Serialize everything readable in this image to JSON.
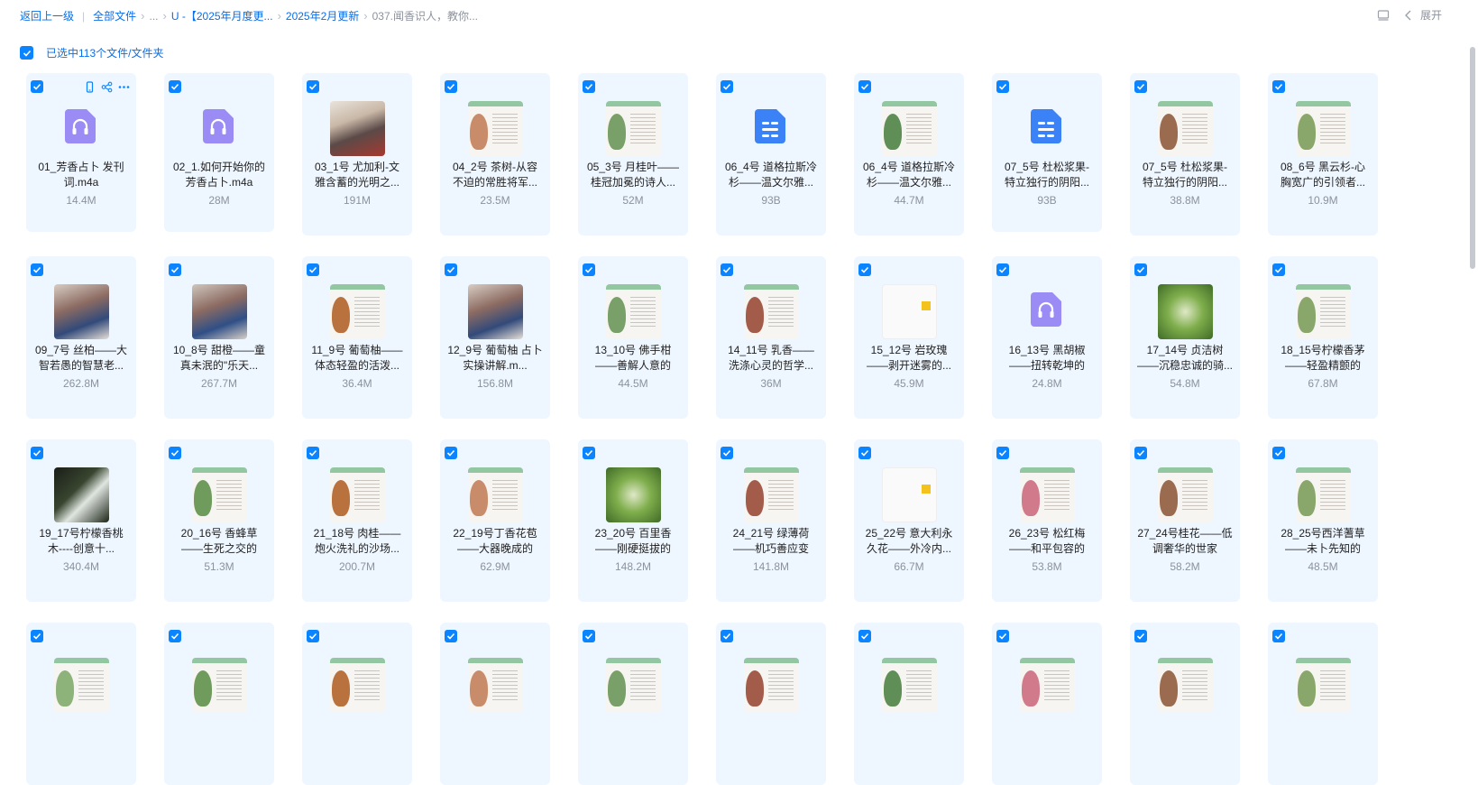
{
  "breadcrumb": {
    "back": "返回上一级",
    "all_files": "全部文件",
    "ellipsis": "...",
    "level1": "U -【2025年月度更...",
    "level2": "2025年2月更新",
    "current": "037.闻香识人，教你..."
  },
  "top_right": {
    "expand_label": "展开",
    "layout_icon": "layout-icon",
    "chevron_icon": "chevron-left-icon"
  },
  "selection": {
    "label": "已选中113个文件/文件夹"
  },
  "colors": {
    "accent": "#0a84ff",
    "link": "#0a6ee8",
    "card_bg": "#eef6ff",
    "audio_icon": "#9b8cf5",
    "doc_icon": "#3b82f6"
  },
  "files": [
    {
      "name": "01_芳香占卜 发刊词.m4a",
      "size": "14.4M",
      "kind": "audio",
      "hovered": true
    },
    {
      "name": "02_1.如何开始你的芳香占卜.m4a",
      "size": "28M",
      "kind": "audio"
    },
    {
      "name": "03_1号 尤加利-文雅含蓄的光明之...",
      "size": "191M",
      "kind": "video-person"
    },
    {
      "name": "04_2号 茶树-从容不迫的常胜将军...",
      "size": "23.5M",
      "kind": "page"
    },
    {
      "name": "05_3号 月桂叶——桂冠加冕的诗人...",
      "size": "52M",
      "kind": "page"
    },
    {
      "name": "06_4号 道格拉斯冷杉——温文尔雅...",
      "size": "93B",
      "kind": "doc"
    },
    {
      "name": "06_4号 道格拉斯冷杉——温文尔雅...",
      "size": "44.7M",
      "kind": "page"
    },
    {
      "name": "07_5号 杜松浆果-特立独行的阴阳...",
      "size": "93B",
      "kind": "doc"
    },
    {
      "name": "07_5号 杜松浆果-特立独行的阴阳...",
      "size": "38.8M",
      "kind": "page"
    },
    {
      "name": "08_6号 黑云杉-心胸宽广的引领者...",
      "size": "10.9M",
      "kind": "page"
    },
    {
      "name": "09_7号 丝柏——大智若愚的智慧老...",
      "size": "262.8M",
      "kind": "video-people"
    },
    {
      "name": "10_8号 甜橙——童真未泯的\"乐天...",
      "size": "267.7M",
      "kind": "video-people2"
    },
    {
      "name": "11_9号 葡萄柚——体态轻盈的活泼...",
      "size": "36.4M",
      "kind": "page"
    },
    {
      "name": "12_9号 葡萄柚 占卜实操讲解.m...",
      "size": "156.8M",
      "kind": "video-people"
    },
    {
      "name": "13_10号 佛手柑——善解人意的",
      "size": "44.5M",
      "kind": "page"
    },
    {
      "name": "14_11号 乳香——洗涤心灵的哲学...",
      "size": "36M",
      "kind": "page"
    },
    {
      "name": "15_12号 岩玫瑰——剥开迷雾的...",
      "size": "45.9M",
      "kind": "plain"
    },
    {
      "name": "16_13号 黑胡椒——扭转乾坤的",
      "size": "24.8M",
      "kind": "audio"
    },
    {
      "name": "17_14号 贞洁树——沉稳忠诚的骑...",
      "size": "54.8M",
      "kind": "green"
    },
    {
      "name": "18_15号柠檬香茅——轻盈精颤的",
      "size": "67.8M",
      "kind": "page"
    },
    {
      "name": "19_17号柠檬香桃木----创意十...",
      "size": "340.4M",
      "kind": "dark"
    },
    {
      "name": "20_16号 香蜂草——生死之交的",
      "size": "51.3M",
      "kind": "page"
    },
    {
      "name": "21_18号 肉桂——炮火洗礼的沙场...",
      "size": "200.7M",
      "kind": "page"
    },
    {
      "name": "22_19号丁香花苞——大器晚成的",
      "size": "62.9M",
      "kind": "page"
    },
    {
      "name": "23_20号 百里香——刚硬挺拔的",
      "size": "148.2M",
      "kind": "green"
    },
    {
      "name": "24_21号 绿薄荷——机巧善应变",
      "size": "141.8M",
      "kind": "page"
    },
    {
      "name": "25_22号 意大利永久花——外冷内...",
      "size": "66.7M",
      "kind": "plain"
    },
    {
      "name": "26_23号 松红梅——和平包容的",
      "size": "53.8M",
      "kind": "page"
    },
    {
      "name": "27_24号桂花——低调奢华的世家",
      "size": "58.2M",
      "kind": "page"
    },
    {
      "name": "28_25号西洋蓍草——未卜先知的",
      "size": "48.5M",
      "kind": "page"
    },
    {
      "name": "",
      "size": "",
      "kind": "page"
    },
    {
      "name": "",
      "size": "",
      "kind": "page"
    },
    {
      "name": "",
      "size": "",
      "kind": "page"
    },
    {
      "name": "",
      "size": "",
      "kind": "page"
    },
    {
      "name": "",
      "size": "",
      "kind": "page"
    },
    {
      "name": "",
      "size": "",
      "kind": "page"
    },
    {
      "name": "",
      "size": "",
      "kind": "page"
    },
    {
      "name": "",
      "size": "",
      "kind": "page"
    },
    {
      "name": "",
      "size": "",
      "kind": "page"
    },
    {
      "name": "",
      "size": "",
      "kind": "page"
    }
  ]
}
